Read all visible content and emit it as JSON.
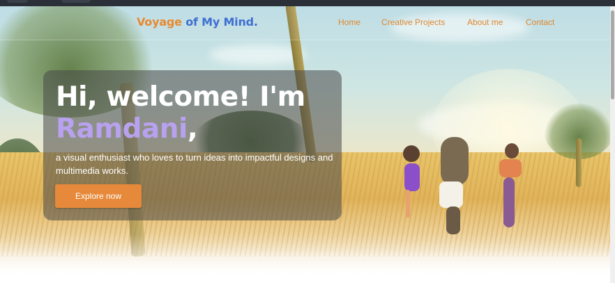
{
  "navbar": {
    "brand_part1": "Voyage",
    "brand_part2": " of My Mind.",
    "links": [
      "Home",
      "Creative Projects",
      "About me",
      "Contact"
    ]
  },
  "hero": {
    "greeting": "Hi, welcome! I'm",
    "name": "Ramdani",
    "name_suffix": ",",
    "description": "a visual enthusiast who loves to turn ideas into impactful designs and multimedia works.",
    "cta_label": "Explore now"
  },
  "colors": {
    "accent_orange": "#e6893a",
    "brand_blue": "#3f6fd1",
    "name_lavender": "#b8a1ee",
    "card_overlay": "rgba(72,72,72,0.55)"
  }
}
